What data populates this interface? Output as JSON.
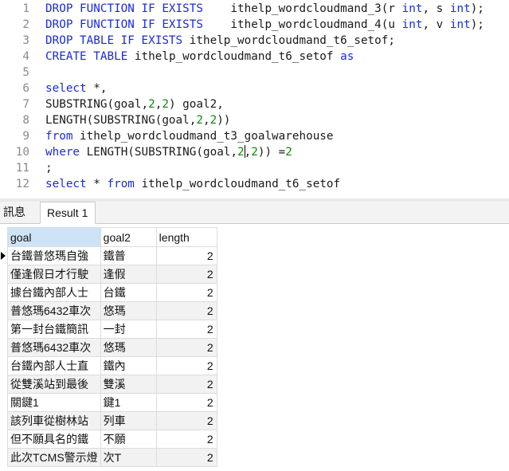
{
  "editor": {
    "lines": [
      {
        "n": "1",
        "segs": [
          [
            "kw",
            "DROP FUNCTION IF EXISTS"
          ],
          [
            "t",
            "    ithelp_wordcloudmand_3(r "
          ],
          [
            "kw",
            "int"
          ],
          [
            "t",
            ", s "
          ],
          [
            "kw",
            "int"
          ],
          [
            "t",
            ");"
          ]
        ]
      },
      {
        "n": "2",
        "segs": [
          [
            "kw",
            "DROP FUNCTION IF EXISTS"
          ],
          [
            "t",
            "    ithelp_wordcloudmand_4(u "
          ],
          [
            "kw",
            "int"
          ],
          [
            "t",
            ", v "
          ],
          [
            "kw",
            "int"
          ],
          [
            "t",
            ");"
          ]
        ]
      },
      {
        "n": "3",
        "segs": [
          [
            "kw",
            "DROP TABLE IF EXISTS"
          ],
          [
            "t",
            " ithelp_wordcloudmand_t6_setof;"
          ]
        ]
      },
      {
        "n": "4",
        "segs": [
          [
            "kw",
            "CREATE TABLE"
          ],
          [
            "t",
            " ithelp_wordcloudmand_t6_setof "
          ],
          [
            "kw",
            "as"
          ]
        ]
      },
      {
        "n": "5",
        "segs": []
      },
      {
        "n": "6",
        "segs": [
          [
            "kw",
            "select"
          ],
          [
            "t",
            " *,"
          ]
        ]
      },
      {
        "n": "7",
        "segs": [
          [
            "t",
            "SUBSTRING(goal,"
          ],
          [
            "num",
            "2"
          ],
          [
            "t",
            ","
          ],
          [
            "num",
            "2"
          ],
          [
            "t",
            ") goal2,"
          ]
        ]
      },
      {
        "n": "8",
        "segs": [
          [
            "t",
            "LENGTH(SUBSTRING(goal,"
          ],
          [
            "num",
            "2"
          ],
          [
            "t",
            ","
          ],
          [
            "num",
            "2"
          ],
          [
            "t",
            "))"
          ]
        ]
      },
      {
        "n": "9",
        "segs": [
          [
            "kw",
            "from"
          ],
          [
            "t",
            " ithelp_wordcloudmand_t3_goalwarehouse"
          ]
        ]
      },
      {
        "n": "10",
        "segs": [
          [
            "kw",
            "where"
          ],
          [
            "t",
            " LENGTH(SUBSTRING(goal,"
          ],
          [
            "num",
            "2"
          ],
          [
            "caret",
            ""
          ],
          [
            "t",
            ","
          ],
          [
            "num",
            "2"
          ],
          [
            "t",
            ")) ="
          ],
          [
            "num",
            "2"
          ]
        ]
      },
      {
        "n": "11",
        "segs": [
          [
            "t",
            ";"
          ]
        ]
      },
      {
        "n": "12",
        "segs": [
          [
            "kw",
            "select"
          ],
          [
            "t",
            " * "
          ],
          [
            "kw",
            "from"
          ],
          [
            "t",
            " ithelp_wordcloudmand_t6_setof"
          ]
        ]
      }
    ]
  },
  "tabs": {
    "info": "訊息",
    "result": "Result 1"
  },
  "grid": {
    "columns": [
      "goal",
      "goal2",
      "length"
    ],
    "rows": [
      [
        "台鐵普悠瑪自強",
        "鐵普",
        "2"
      ],
      [
        "僅逢假日才行駛",
        "逢假",
        "2"
      ],
      [
        "據台鐵內部人士",
        "台鐵",
        "2"
      ],
      [
        "普悠瑪6432車次",
        "悠瑪",
        "2"
      ],
      [
        "第一封台鐵簡訊",
        "一封",
        "2"
      ],
      [
        "普悠瑪6432車次",
        "悠瑪",
        "2"
      ],
      [
        "台鐵內部人士直",
        "鐵內",
        "2"
      ],
      [
        "從雙溪站到最後",
        "雙溪",
        "2"
      ],
      [
        "關鍵1",
        "鍵1",
        "2"
      ],
      [
        "該列車從樹林站",
        "列車",
        "2"
      ],
      [
        "但不願具名的鐵",
        "不願",
        "2"
      ],
      [
        "此次TCMS警示燈",
        "次T",
        "2"
      ]
    ]
  }
}
